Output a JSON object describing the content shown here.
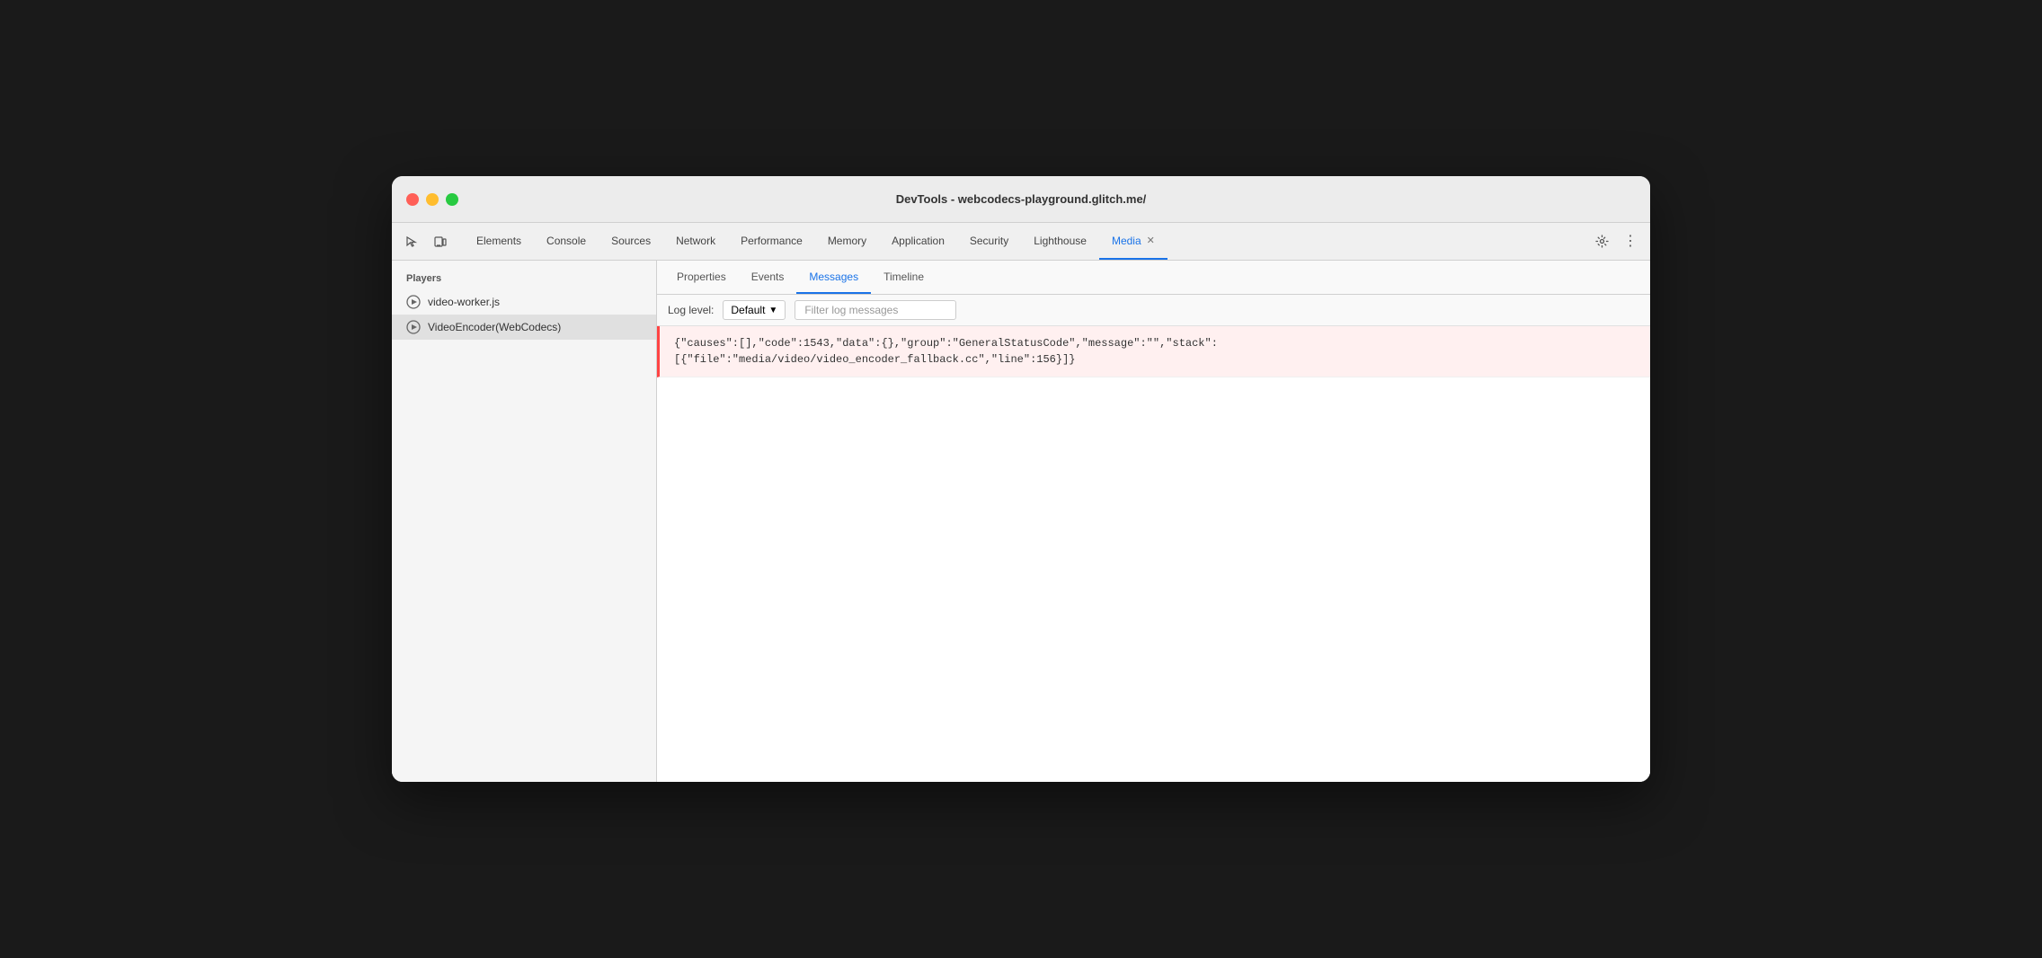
{
  "window": {
    "title": "DevTools - webcodecs-playground.glitch.me/"
  },
  "toolbar": {
    "nav_tabs": [
      {
        "id": "elements",
        "label": "Elements",
        "active": false,
        "closable": false
      },
      {
        "id": "console",
        "label": "Console",
        "active": false,
        "closable": false
      },
      {
        "id": "sources",
        "label": "Sources",
        "active": false,
        "closable": false
      },
      {
        "id": "network",
        "label": "Network",
        "active": false,
        "closable": false
      },
      {
        "id": "performance",
        "label": "Performance",
        "active": false,
        "closable": false
      },
      {
        "id": "memory",
        "label": "Memory",
        "active": false,
        "closable": false
      },
      {
        "id": "application",
        "label": "Application",
        "active": false,
        "closable": false
      },
      {
        "id": "security",
        "label": "Security",
        "active": false,
        "closable": false
      },
      {
        "id": "lighthouse",
        "label": "Lighthouse",
        "active": false,
        "closable": false
      },
      {
        "id": "media",
        "label": "Media",
        "active": true,
        "closable": true
      }
    ]
  },
  "sidebar": {
    "header": "Players",
    "players": [
      {
        "id": "video-worker",
        "label": "video-worker.js",
        "selected": false
      },
      {
        "id": "video-encoder",
        "label": "VideoEncoder(WebCodecs)",
        "selected": true
      }
    ]
  },
  "sub_tabs": [
    {
      "id": "properties",
      "label": "Properties",
      "active": false
    },
    {
      "id": "events",
      "label": "Events",
      "active": false
    },
    {
      "id": "messages",
      "label": "Messages",
      "active": true
    },
    {
      "id": "timeline",
      "label": "Timeline",
      "active": false
    }
  ],
  "log_toolbar": {
    "level_label": "Log level:",
    "level_value": "Default",
    "filter_placeholder": "Filter log messages"
  },
  "log_entries": [
    {
      "type": "error",
      "text": "{\"causes\":[],\"code\":1543,\"data\":{},\"group\":\"GeneralStatusCode\",\"message\":\"\",\"stack\":\n[{\"file\":\"media/video/video_encoder_fallback.cc\",\"line\":156}]}"
    }
  ],
  "icons": {
    "cursor": "⬚",
    "device": "⬚",
    "gear": "⚙",
    "dots": "⋮"
  }
}
